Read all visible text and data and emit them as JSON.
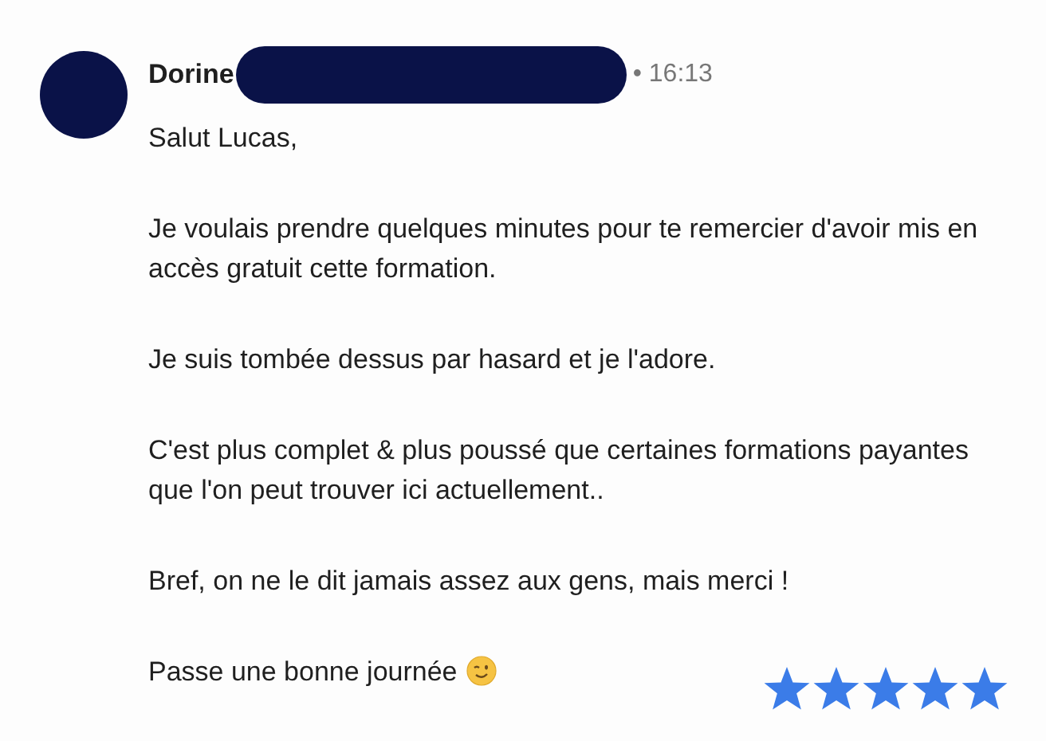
{
  "message": {
    "sender": "Dorine",
    "time": "• 16:13",
    "paragraphs": [
      "Salut Lucas,",
      "Je voulais prendre quelques minutes pour te remercier d'avoir mis en accès gratuit cette formation.",
      "Je suis tombée dessus par hasard et je l'adore.",
      "C'est plus complet & plus poussé que certaines formations payantes que l'on peut trouver ici actuellement..",
      "Bref, on ne le dit jamais assez aux gens, mais merci !",
      "Passe une bonne journée"
    ],
    "rating": {
      "stars": 5
    }
  }
}
